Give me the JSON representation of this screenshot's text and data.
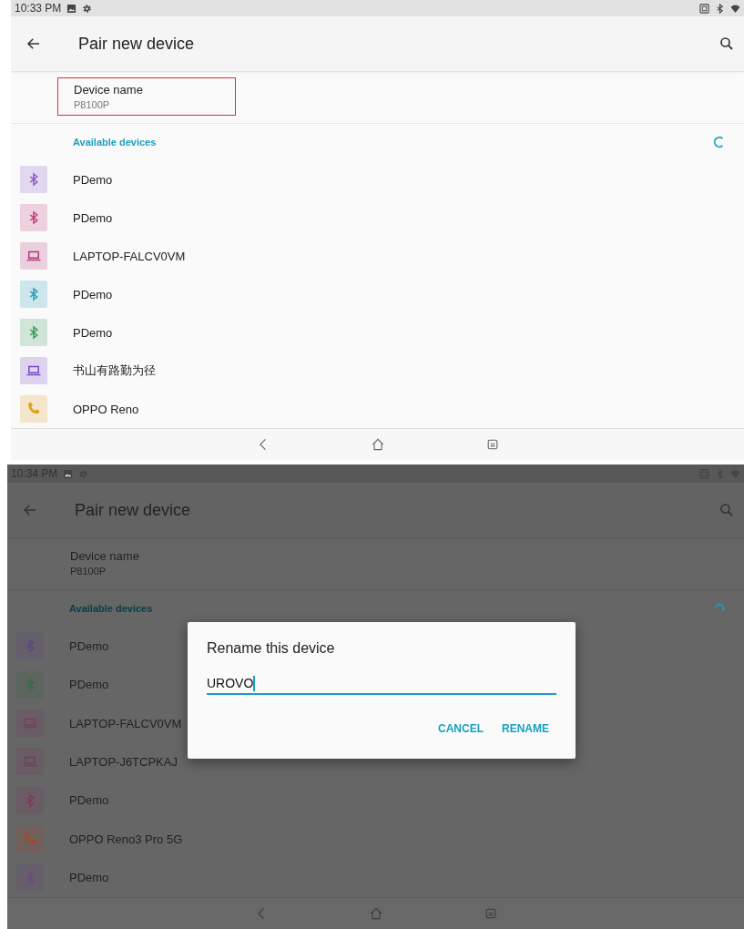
{
  "screens": [
    {
      "status_bar": {
        "time": "10:33 PM"
      },
      "app_bar": {
        "title": "Pair new device"
      },
      "device_name": {
        "label": "Device name",
        "value": "P8100P",
        "highlighted": true
      },
      "section_title": "Available devices",
      "devices": [
        {
          "name": "PDemo",
          "kind": "bluetooth",
          "color": "#8a5cc9"
        },
        {
          "name": "PDemo",
          "kind": "bluetooth",
          "color": "#c2407e"
        },
        {
          "name": "LAPTOP-FALCV0VM",
          "kind": "laptop",
          "color": "#b03a7a"
        },
        {
          "name": "PDemo",
          "kind": "bluetooth",
          "color": "#2a9fb5"
        },
        {
          "name": "PDemo",
          "kind": "bluetooth",
          "color": "#3c9a5f"
        },
        {
          "name": "书山有路勤为径",
          "kind": "laptop",
          "color": "#7b47c4"
        },
        {
          "name": "OPPO Reno",
          "kind": "phone",
          "color": "#e0a020"
        }
      ]
    },
    {
      "status_bar": {
        "time": "10:34 PM"
      },
      "app_bar": {
        "title": "Pair new device"
      },
      "device_name": {
        "label": "Device name",
        "value": "P8100P",
        "highlighted": false
      },
      "section_title": "Available devices",
      "devices": [
        {
          "name": "PDemo",
          "kind": "bluetooth",
          "color": "#5c4a80"
        },
        {
          "name": "PDemo",
          "kind": "bluetooth",
          "color": "#3a6a48"
        },
        {
          "name": "LAPTOP-FALCV0VM",
          "kind": "laptop",
          "color": "#7a3a60"
        },
        {
          "name": "LAPTOP-J6TCPKAJ",
          "kind": "laptop",
          "color": "#7a3a60"
        },
        {
          "name": "PDemo",
          "kind": "bluetooth",
          "color": "#7d3a62"
        },
        {
          "name": "OPPO Reno3 Pro 5G",
          "kind": "phone",
          "color": "#a04a30"
        },
        {
          "name": "PDemo",
          "kind": "bluetooth",
          "color": "#6a4a80"
        }
      ],
      "dialog": {
        "title": "Rename this device",
        "value": "UROVO",
        "buttons": [
          "CANCEL",
          "RENAME"
        ]
      }
    }
  ]
}
